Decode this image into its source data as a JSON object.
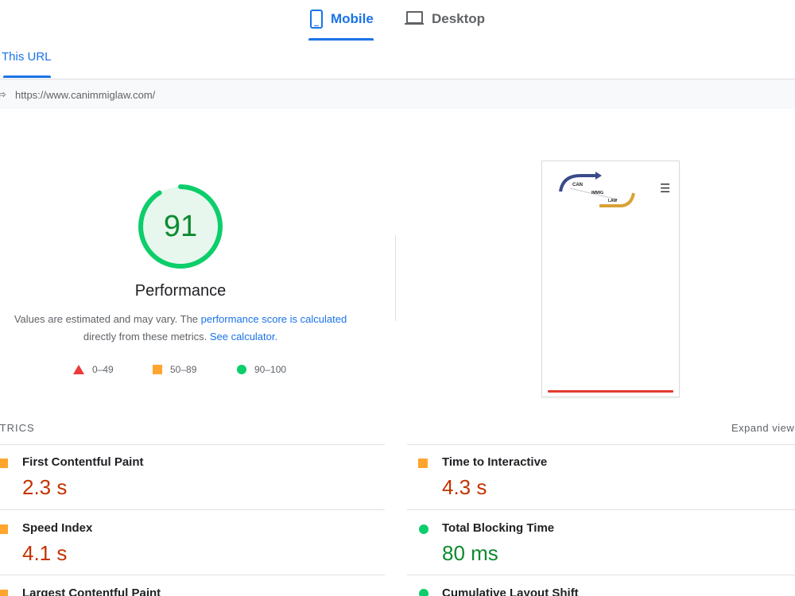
{
  "device_tabs": {
    "mobile": {
      "label": "Mobile",
      "icon": "phone-icon",
      "selected": true
    },
    "desktop": {
      "label": "Desktop",
      "icon": "laptop-icon",
      "selected": false
    }
  },
  "url_tab": {
    "label": "This URL"
  },
  "url_bar": {
    "icon": "link-icon",
    "url": "https://www.canimmiglaw.com/"
  },
  "performance": {
    "score": "91",
    "score_fraction": 0.91,
    "title": "Performance",
    "description_prefix": "Values are estimated and may vary. The ",
    "description_link": "performance score is calculated",
    "description_mid": "directly from these metrics. ",
    "description_link2": "See calculator.",
    "legend": [
      {
        "range": "0–49",
        "icon": "fail-triangle-icon",
        "color": "#eb3a3a"
      },
      {
        "range": "50–89",
        "icon": "average-square-icon",
        "color": "#ffa52e"
      },
      {
        "range": "90–100",
        "icon": "pass-circle-icon",
        "color": "#0cce6b"
      }
    ]
  },
  "screenshot": {
    "logo_text": [
      "CAN",
      "IMMIG",
      "LAW"
    ],
    "menu_icon": "hamburger-icon"
  },
  "metrics": {
    "header": "ETRICS",
    "expand_label": "Expand view",
    "items": [
      {
        "name": "First Contentful Paint",
        "value": "2.3 s",
        "rating": "average"
      },
      {
        "name": "Time to Interactive",
        "value": "4.3 s",
        "rating": "average"
      },
      {
        "name": "Speed Index",
        "value": "4.1 s",
        "rating": "average"
      },
      {
        "name": "Total Blocking Time",
        "value": "80 ms",
        "rating": "pass"
      },
      {
        "name": "Largest Contentful Paint",
        "value": "",
        "rating": "average"
      },
      {
        "name": "Cumulative Layout Shift",
        "value": "",
        "rating": "pass"
      }
    ]
  },
  "colors": {
    "accent": "#1a73e8",
    "pass": "#0cce6b",
    "average": "#ffa52e",
    "fail": "#eb3a3a",
    "score_text": "#0d8a2f"
  }
}
